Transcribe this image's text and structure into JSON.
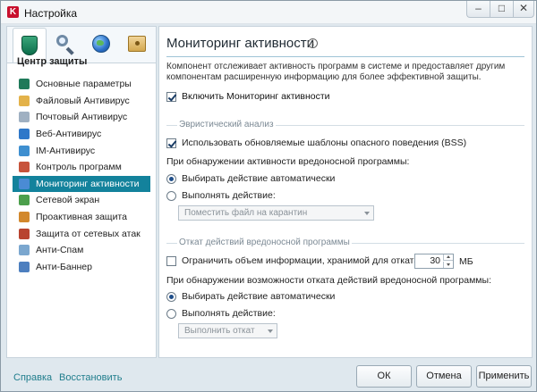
{
  "window": {
    "title": "Настройка"
  },
  "titlebar": {
    "minimize": "–",
    "maximize": "□",
    "close": "✕"
  },
  "sidebar": {
    "tabs": [
      {
        "name": "protection-tab",
        "icon": "shield-icon"
      },
      {
        "name": "scan-tab",
        "icon": "magnifier-icon"
      },
      {
        "name": "update-tab",
        "icon": "globe-icon"
      },
      {
        "name": "settings-tab",
        "icon": "safe-icon"
      }
    ],
    "heading": "Центр защиты",
    "items": [
      {
        "label": "Основные параметры",
        "icon": "shield-icon",
        "color": "#1f7a5a"
      },
      {
        "label": "Файловый Антивирус",
        "icon": "folder-icon",
        "color": "#e3b24a"
      },
      {
        "label": "Почтовый Антивирус",
        "icon": "envelope-icon",
        "color": "#9fb0c2"
      },
      {
        "label": "Веб-Антивирус",
        "icon": "globe-icon",
        "color": "#2f78c9"
      },
      {
        "label": "IM-Антивирус",
        "icon": "chat-icon",
        "color": "#3e8fd0"
      },
      {
        "label": "Контроль программ",
        "icon": "program-icon",
        "color": "#c7533b"
      },
      {
        "label": "Мониторинг активности",
        "icon": "monitor-icon",
        "color": "#4a8bd4",
        "active": true
      },
      {
        "label": "Сетевой экран",
        "icon": "firewall-icon",
        "color": "#4c9f4c"
      },
      {
        "label": "Проактивная защита",
        "icon": "proactive-icon",
        "color": "#d2882c"
      },
      {
        "label": "Защита от сетевых атак",
        "icon": "network-attack-icon",
        "color": "#b8432f"
      },
      {
        "label": "Анти-Спам",
        "icon": "antispam-icon",
        "color": "#7ba7cf"
      },
      {
        "label": "Анти-Баннер",
        "icon": "antibanner-icon",
        "color": "#4d7fbf"
      }
    ]
  },
  "main": {
    "title": "Мониторинг активности",
    "description": "Компонент отслеживает активность программ в системе и предоставляет другим компонентам расширенную информацию для более эффективной защиты.",
    "enable_label": "Включить Мониторинг активности",
    "heuristic": {
      "section_title": "Эвристический анализ",
      "bss_label": "Использовать обновляемые шаблоны опасного поведения (BSS)",
      "prompt": "При обнаружении активности вредоносной программы:",
      "auto_label": "Выбирать действие автоматически",
      "manual_label": "Выполнять действие:",
      "action_value": "Поместить файл на карантин"
    },
    "rollback": {
      "section_title": "Откат действий вредоносной программы",
      "limit_label": "Ограничить объем информации, хранимой для отката:",
      "limit_value": "30",
      "limit_unit": "МБ",
      "prompt": "При обнаружении возможности отката действий вредоносной программы:",
      "auto_label": "Выбирать действие автоматически",
      "manual_label": "Выполнять действие:",
      "action_value": "Выполнить откат"
    }
  },
  "footer": {
    "help": "Справка",
    "restore": "Восстановить",
    "ok": "ОК",
    "cancel": "Отмена",
    "apply": "Применить"
  }
}
